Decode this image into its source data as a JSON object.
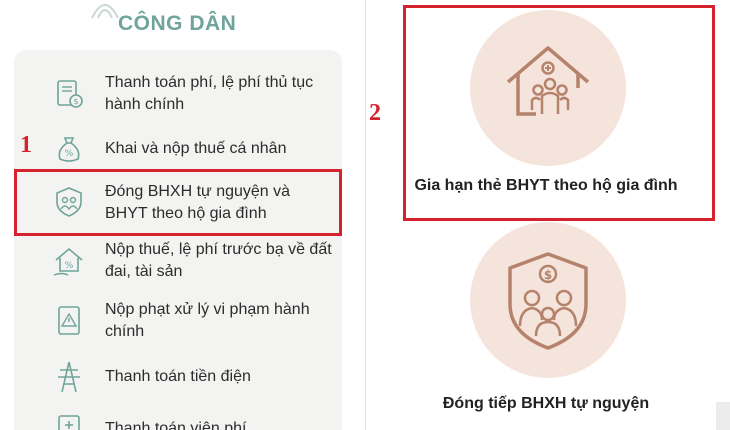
{
  "header": {
    "title": "CÔNG DÂN"
  },
  "menu": {
    "items": [
      {
        "label": "Thanh toán phí, lệ phí thủ tục hành chính",
        "icon": "document-fee-icon"
      },
      {
        "label": "Khai và nộp thuế cá nhân",
        "icon": "money-bag-icon"
      },
      {
        "label": "Đóng BHXH tự nguyện và BHYT theo hộ gia đình",
        "icon": "family-shield-icon"
      },
      {
        "label": "Nộp thuế, lệ phí trước bạ về đất đai, tài sản",
        "icon": "house-fee-icon"
      },
      {
        "label": "Nộp phạt xử lý vi phạm hành chính",
        "icon": "warning-document-icon"
      },
      {
        "label": "Thanh toán tiền điện",
        "icon": "power-tower-icon"
      },
      {
        "label": "Thanh toán viện phí",
        "icon": "hospital-bill-icon"
      }
    ]
  },
  "annotations": {
    "step1": "1",
    "step2": "2"
  },
  "services": [
    {
      "label": "Gia hạn thẻ BHYT theo hộ gia đình",
      "icon": "house-family-icon"
    },
    {
      "label": "Đóng tiếp BHXH tự nguyện",
      "icon": "shield-family-dollar-icon"
    }
  ],
  "colors": {
    "accent": "#6fa49b",
    "highlight": "#d6222e",
    "icon_stroke": "#b5836c",
    "circle_bg": "#f5e4dc"
  }
}
